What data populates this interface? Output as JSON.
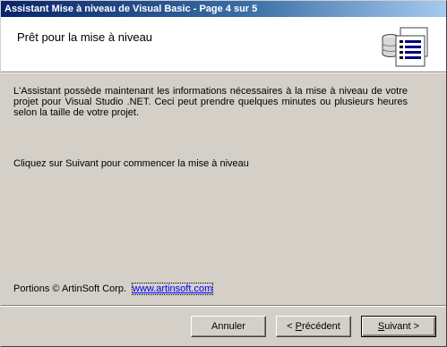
{
  "window": {
    "title": "Assistant Mise à niveau de Visual Basic - Page 4 sur 5"
  },
  "header": {
    "title": "Prêt pour la mise à niveau",
    "icon": "database-document-icon"
  },
  "content": {
    "paragraph1": "L'Assistant possède maintenant les informations nécessaires à la mise à niveau de votre projet pour Visual Studio .NET. Ceci peut prendre quelques minutes ou plusieurs heures selon la taille de votre projet.",
    "paragraph2": "Cliquez sur Suivant pour commencer la mise à niveau",
    "portions": "Portions © ArtinSoft Corp.",
    "link": "www.artinsoft.com"
  },
  "buttons": {
    "cancel": "Annuler",
    "previous_prefix": "< ",
    "previous_accel": "P",
    "previous_rest": "récédent",
    "next_accel": "S",
    "next_rest": "uivant >"
  },
  "colors": {
    "titlebar_start": "#0a246a",
    "titlebar_end": "#a6caf0",
    "dialog_bg": "#d4d0c8",
    "link": "#0000ff"
  }
}
